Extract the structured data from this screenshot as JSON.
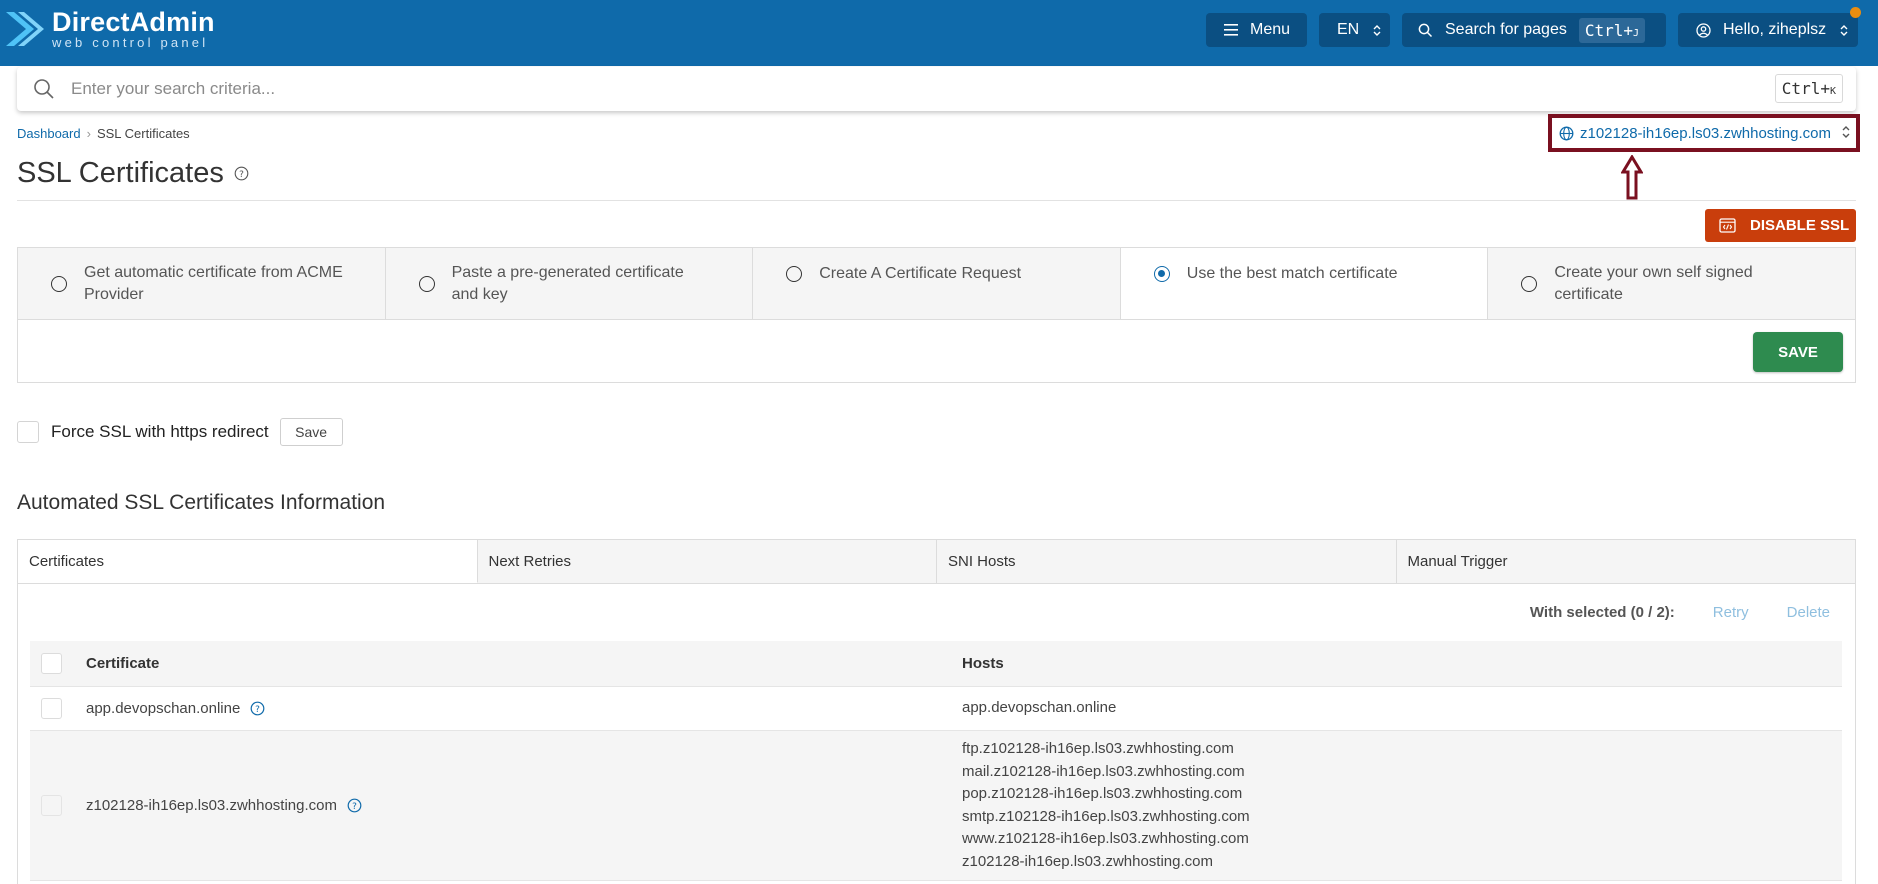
{
  "header": {
    "logo_name": "DirectAdmin",
    "logo_sub": "web control panel",
    "menu_label": "Menu",
    "language": "EN",
    "search_pages_label": "Search for pages",
    "search_pages_shortcut": "Ctrl+",
    "search_pages_shortcut_key": "J",
    "user_greeting": "Hello, ziheplsz",
    "icons": [
      "hamburger-icon",
      "chevron-updown-icon",
      "search-icon",
      "user-icon"
    ]
  },
  "global_search": {
    "placeholder": "Enter your search criteria...",
    "shortcut": "Ctrl+",
    "shortcut_key": "K"
  },
  "breadcrumb": {
    "home": "Dashboard",
    "current": "SSL Certificates"
  },
  "domain_selector": {
    "value": "z102128-ih16ep.ls03.zwhhosting.com"
  },
  "page": {
    "title": "SSL Certificates",
    "disable_ssl_label": "DISABLE SSL"
  },
  "options": [
    {
      "label": "Get automatic certificate from ACME Provider",
      "selected": false
    },
    {
      "label": "Paste a pre-generated certificate and key",
      "selected": false
    },
    {
      "label": "Create A Certificate Request",
      "selected": false
    },
    {
      "label": "Use the best match certificate",
      "selected": true
    },
    {
      "label": "Create your own self signed certificate",
      "selected": false
    }
  ],
  "save_label": "SAVE",
  "force_ssl": {
    "label": "Force SSL with https redirect",
    "checked": false,
    "save_label": "Save"
  },
  "automated": {
    "section_title": "Automated SSL Certificates Information",
    "tabs": [
      "Certificates",
      "Next Retries",
      "SNI Hosts",
      "Manual Trigger"
    ],
    "active_tab": "Certificates",
    "with_selected": "With selected (0 / 2):",
    "retry_label": "Retry",
    "delete_label": "Delete",
    "table": {
      "headers": [
        "Certificate",
        "Hosts"
      ],
      "rows": [
        {
          "certificate": "app.devopschan.online",
          "hosts": [
            "app.devopschan.online"
          ]
        },
        {
          "certificate": "z102128-ih16ep.ls03.zwhhosting.com",
          "hosts": [
            "ftp.z102128-ih16ep.ls03.zwhhosting.com",
            "mail.z102128-ih16ep.ls03.zwhhosting.com",
            "pop.z102128-ih16ep.ls03.zwhhosting.com",
            "smtp.z102128-ih16ep.ls03.zwhhosting.com",
            "www.z102128-ih16ep.ls03.zwhhosting.com",
            "z102128-ih16ep.ls03.zwhhosting.com"
          ]
        }
      ]
    }
  },
  "colors": {
    "header_bg": "#0f6aaa",
    "header_button_bg": "#0b4f82",
    "disable_ssl_bg": "#c93e0c",
    "save_green": "#2e8b4f",
    "highlight_box": "#7a1020",
    "notification_dot": "#e98d10"
  }
}
